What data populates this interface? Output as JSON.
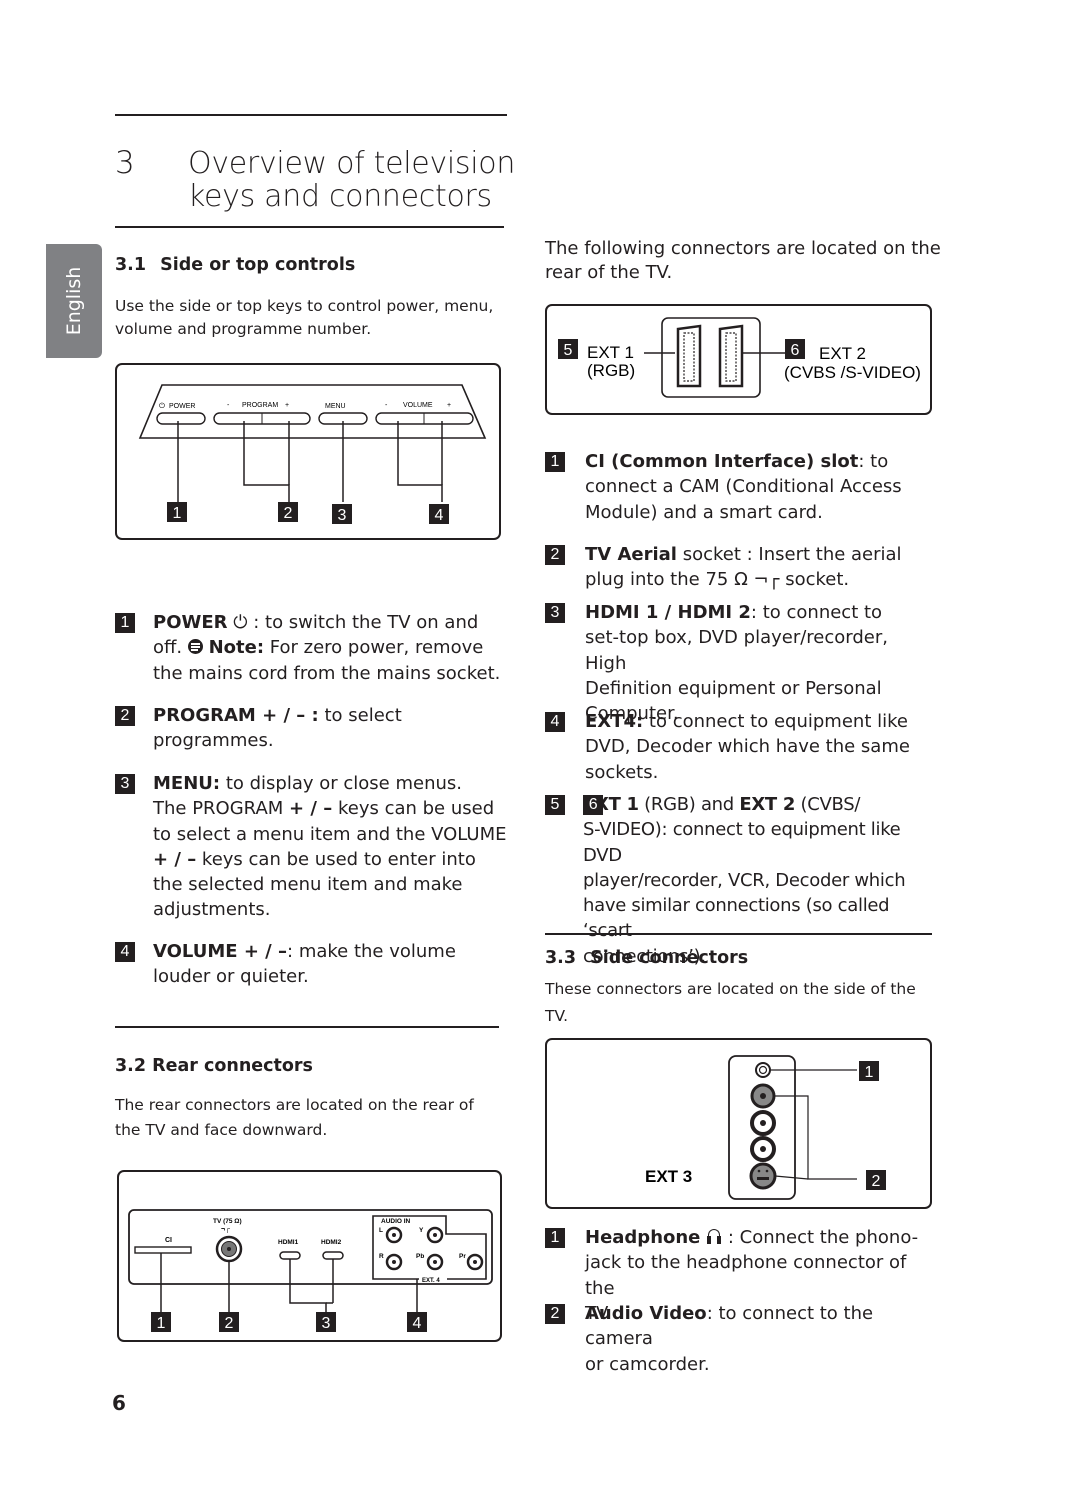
{
  "page": {
    "language_tab": "English",
    "page_number": "6"
  },
  "chapter": {
    "number": "3",
    "title_line1": "Overview of  television",
    "title_line2": "keys and connectors"
  },
  "section_3_1": {
    "heading_num": "3.1",
    "heading": "Side or top controls",
    "intro_line1": "Use the side or top keys to control power, menu,",
    "intro_line2": "volume and programme number.",
    "figure": {
      "labels": {
        "power": "POWER",
        "program": "PROGRAM",
        "menu": "MENU",
        "volume": "VOLUME",
        "minus": "-",
        "plus": "+"
      },
      "callouts": [
        "1",
        "2",
        "3",
        "4"
      ]
    },
    "items": [
      {
        "badge": "1",
        "bold": "POWER",
        "icon": "power-icon",
        "text_after_icon": " : to switch the TV on and",
        "line2_prefix": "off.",
        "note_icon": "note-icon",
        "note_bold": "Note:",
        "note_text": " For zero power, remove",
        "line3": "the mains cord from the mains socket."
      },
      {
        "badge": "2",
        "bold": "PROGRAM + / – :",
        "text": " to select",
        "line2": "programmes."
      },
      {
        "badge": "3",
        "bold": "MENU:",
        "text": " to display or close menus.",
        "line2_a": "The PROGRAM ",
        "line2_b": "+ / –",
        "line2_c": " keys can be used",
        "line3": "to select a menu item and the VOLUME",
        "line4_b": " + / –",
        "line4_c": " keys can be used to enter into",
        "line5": "the selected menu item and make",
        "line6": "adjustments."
      },
      {
        "badge": "4",
        "bold": "VOLUME  + / –",
        "text": ": make the volume",
        "line2": "louder or quieter."
      }
    ]
  },
  "section_3_2": {
    "heading": "3.2 Rear connectors",
    "intro_line1": "The rear connectors are located on the rear of",
    "intro_line2": "the TV and face downward.",
    "figure": {
      "labels": {
        "ci": "CI",
        "tv": "TV (75 Ω)",
        "hdmi1": "HDMI1",
        "hdmi2": "HDMI2",
        "audio_in": "AUDIO IN",
        "l": "L",
        "r": "R",
        "y": "Y",
        "pb": "Pb",
        "pr": "Pr",
        "ext4": "EXT. 4"
      },
      "callouts": [
        "1",
        "2",
        "3",
        "4"
      ]
    }
  },
  "right_column": {
    "intro_line1": "The following connectors are located on the",
    "intro_line2": "rear of the TV.",
    "scart_figure": {
      "badge5": "5",
      "ext1": "EXT 1",
      "ext1_sub": "(RGB)",
      "badge6": "6",
      "ext2": "EXT 2",
      "ext2_sub": "(CVBS /S-VIDEO)"
    },
    "items": [
      {
        "badge": "1",
        "bold": "CI (Common Interface) slot",
        "text": ": to",
        "line2": "connect a CAM (Conditional Access",
        "line3": "Module) and a smart card."
      },
      {
        "badge": "2",
        "bold": "TV Aerial",
        "text": " socket : Insert the aerial",
        "line2": "plug into the  75 Ω ¬┌ socket."
      },
      {
        "badge": "3",
        "bold": "HDMI 1 / HDMI 2",
        "text": ": to connect to",
        "line2": "set-top box, DVD player/recorder, High",
        "line3": "Definition equipment or Personal",
        "line4": "Computer."
      },
      {
        "badge": "4",
        "bold": "EXT4:",
        "text": " to connect to equipment like",
        "line2": "DVD, Decoder which have the same",
        "line3": "sockets."
      },
      {
        "badge": "5",
        "bold": "EXT 1",
        "text": " (RGB) and ",
        "badge2": "6",
        "bold2": "EXT 2",
        "text2": " (CVBS/",
        "line2": "S-VIDEO): connect to equipment like DVD",
        "line3": "player/recorder, VCR, Decoder which",
        "line4": "have similar connections (so called ‘scart",
        "line5": "connections’)."
      }
    ]
  },
  "section_3_3": {
    "heading_num": "3.3",
    "heading": "Side connectors",
    "intro_line1": "These connectors are located on the side of the",
    "intro_line2": "TV.",
    "figure": {
      "ext3": "EXT 3",
      "callouts": [
        "1",
        "2"
      ]
    },
    "items": [
      {
        "badge": "1",
        "bold": "Headphone",
        "icon": "headphone-icon",
        "text": " : Connect the phono-",
        "line2": "jack to the headphone connector of the",
        "line3": "TV."
      },
      {
        "badge": "2",
        "bold": "Audio Video",
        "text": ": to connect to the camera",
        "line2": "or camcorder."
      }
    ]
  }
}
